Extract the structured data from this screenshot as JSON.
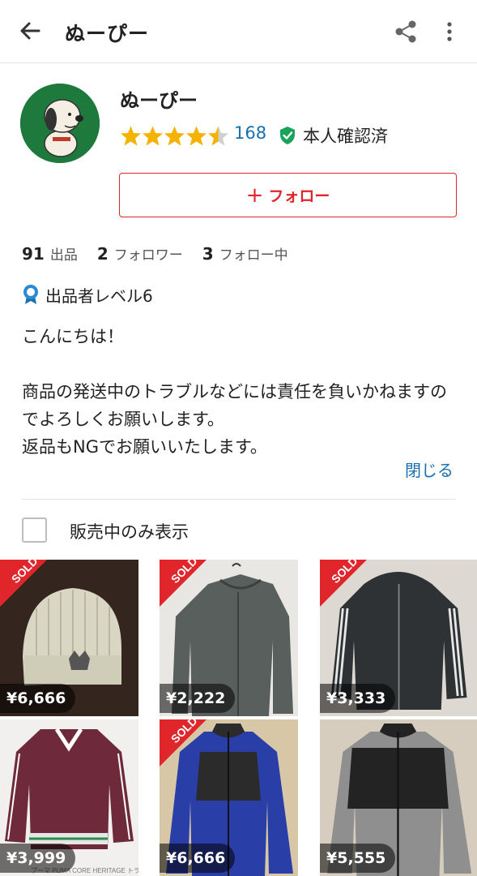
{
  "header": {
    "title": "ぬーぴー"
  },
  "profile": {
    "name": "ぬーぴー",
    "rating": 4.5,
    "rating_count": "168",
    "verified": "本人確認済",
    "follow_button": "フォロー"
  },
  "stats": [
    {
      "value": "91",
      "label": "出品"
    },
    {
      "value": "2",
      "label": "フォロワー"
    },
    {
      "value": "3",
      "label": "フォロー中"
    }
  ],
  "level": "出品者レベル6",
  "bio": "こんにちは！\n\n商品の発送中のトラブルなどには責任を負いかねますのでよろしくお願いします。\n返品もNGでお願いいたします。",
  "close_label": "閉じる",
  "filter": {
    "label": "販売中のみ表示",
    "checked": false
  },
  "items": [
    {
      "price": "¥6,666",
      "sold": true,
      "sold_label": "SOLD",
      "icon": "knit-beanie"
    },
    {
      "price": "¥2,222",
      "sold": true,
      "sold_label": "SOLD",
      "icon": "gray-jacket"
    },
    {
      "price": "¥3,333",
      "sold": true,
      "sold_label": "SOLD",
      "icon": "black-hoodie"
    },
    {
      "price": "¥3,999",
      "sold": false,
      "caption": "プーマ PUMA CORE HERITAGE トラックジャケット…",
      "icon": "maroon-track-jacket"
    },
    {
      "price": "¥6,666",
      "sold": true,
      "sold_label": "SOLD",
      "icon": "blue-fleece"
    },
    {
      "price": "¥5,555",
      "sold": false,
      "icon": "gray-fleece"
    }
  ],
  "colors": {
    "accent": "#e0262b",
    "link": "#1a6fb0",
    "star": "#f5b301",
    "verified": "#1aa35a"
  }
}
